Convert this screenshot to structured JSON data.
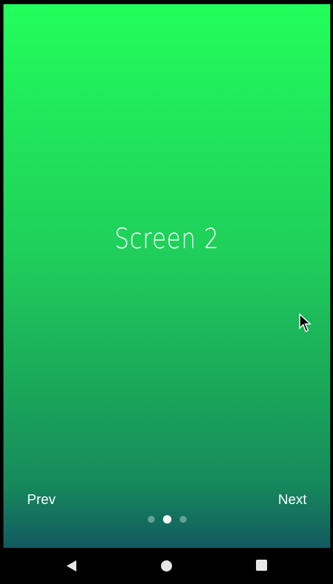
{
  "screen": {
    "title": "Screen 2"
  },
  "controls": {
    "prev_label": "Prev",
    "next_label": "Next"
  },
  "pager": {
    "total": 3,
    "active_index": 1
  },
  "colors": {
    "gradient_top": "#23ff5b",
    "gradient_bottom": "#125a60",
    "text": "#ffffff"
  },
  "system_nav": {
    "icons": [
      "back-icon",
      "home-icon",
      "recent-apps-icon"
    ]
  }
}
